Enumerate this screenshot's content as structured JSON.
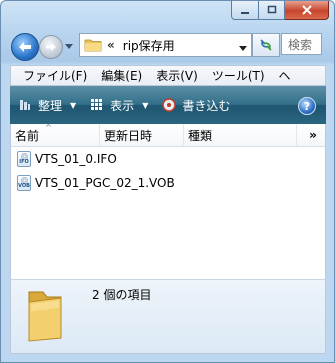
{
  "window": {
    "caption_buttons": [
      "minimize",
      "maximize",
      "close"
    ]
  },
  "address": {
    "chevron": "«",
    "path": "rip保存用"
  },
  "search": {
    "placeholder": "検索"
  },
  "menu": {
    "items": [
      "ファイル(F)",
      "編集(E)",
      "表示(V)",
      "ツール(T)",
      "ヘ"
    ]
  },
  "commands": {
    "organize": "整理",
    "views": "表示",
    "burn": "書き込む",
    "help_icon": "help-icon"
  },
  "columns": {
    "name": "名前",
    "modified": "更新日時",
    "type": "種類",
    "more": "»"
  },
  "files": [
    {
      "name": "VTS_01_0.IFO",
      "icon_tag": "IFO"
    },
    {
      "name": "VTS_01_PGC_02_1.VOB",
      "icon_tag": "VOB"
    }
  ],
  "details": {
    "item_count": "2 個の項目"
  },
  "colors": {
    "command_bar": "#336f8a",
    "accent": "#2a75c9",
    "close": "#c7442d"
  }
}
